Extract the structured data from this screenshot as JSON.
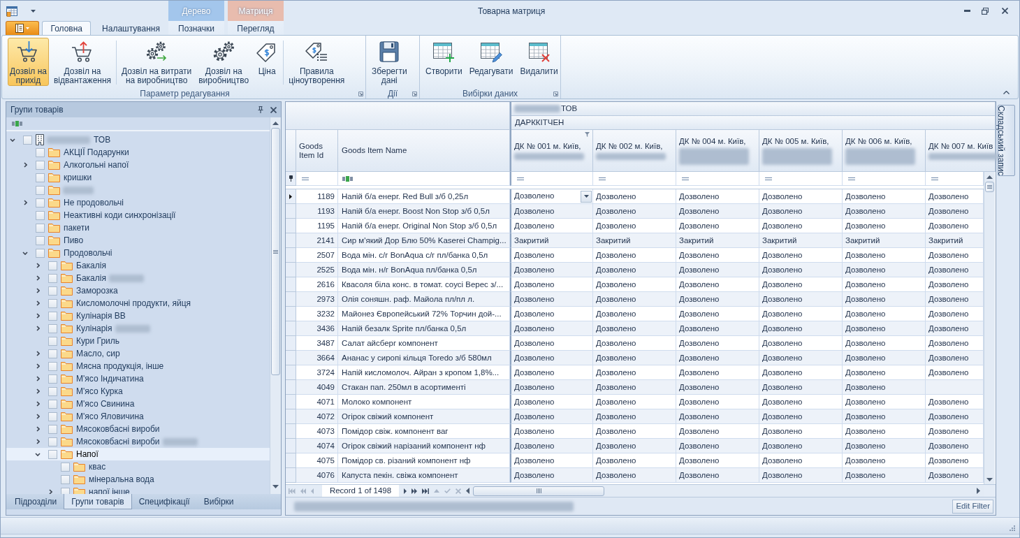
{
  "window": {
    "title": "Товарна матриця"
  },
  "ribbon": {
    "tabs": [
      {
        "label": "Головна",
        "selected": true
      },
      {
        "label": "Налаштування",
        "selected": false
      }
    ],
    "contextual_groups": [
      {
        "label": "Дерево",
        "color": "#a3c6ec",
        "tabs": [
          {
            "label": "Позначки",
            "selected": false
          }
        ]
      },
      {
        "label": "Матриця",
        "color": "#e8bcae",
        "tabs": [
          {
            "label": "Перегляд",
            "selected": false
          }
        ]
      }
    ],
    "groups": [
      {
        "label": "Параметр редагування",
        "sections": [
          [
            {
              "label": "Дозвіл на\nприхід",
              "selected": true
            },
            {
              "label": "Дозвіл на\nвідвантаження",
              "selected": false
            }
          ],
          [
            {
              "label": "Дозвіл на витрати\nна виробництво",
              "selected": false
            },
            {
              "label": "Дозвіл на\nвиробництво",
              "selected": false
            },
            {
              "label": "Ціна",
              "selected": false
            }
          ],
          [
            {
              "label": "Правила\nціноутворення",
              "selected": false
            }
          ]
        ]
      },
      {
        "label": "Дії",
        "sections": [
          [
            {
              "label": "Зберегти\nдані",
              "selected": false
            }
          ]
        ]
      },
      {
        "label": "Вибірки даних",
        "sections": [
          [
            {
              "label": "Створити",
              "selected": false
            },
            {
              "label": "Редагувати",
              "selected": false
            },
            {
              "label": "Видалити",
              "selected": false
            }
          ]
        ]
      }
    ]
  },
  "side_panel": {
    "title": "Групи товарів",
    "tree": [
      {
        "label": "ТОВ",
        "redacted_before": true,
        "kind": "company",
        "checked": false,
        "selected": false,
        "expanded": true,
        "children": [
          {
            "label": "АКЦІЇ Подарунки",
            "kind": "folder",
            "checked": false,
            "selected": false
          },
          {
            "label": "Алкогольні напої",
            "kind": "folder",
            "checked": false,
            "selected": false,
            "expanded": false
          },
          {
            "label": "кришки",
            "kind": "folder",
            "checked": false,
            "selected": false
          },
          {
            "redacted_after": true,
            "kind": "folder",
            "checked": false,
            "selected": false
          },
          {
            "label": "Не продовольчі",
            "kind": "folder",
            "checked": false,
            "selected": false,
            "expanded": false
          },
          {
            "label": "Неактивні коди синхронізації",
            "kind": "folder",
            "checked": false,
            "selected": false
          },
          {
            "label": "пакети",
            "kind": "folder",
            "checked": false,
            "selected": false
          },
          {
            "label": "Пиво",
            "kind": "folder",
            "checked": false,
            "selected": false
          },
          {
            "label": "Продовольчі",
            "kind": "folder",
            "checked": false,
            "selected": false,
            "expanded": true,
            "children": [
              {
                "label": "Бакалія",
                "kind": "folder",
                "checked": false,
                "selected": false,
                "expanded": false
              },
              {
                "label": "Бакалія",
                "redacted_after": true,
                "kind": "folder",
                "checked": false,
                "selected": false,
                "expanded": false
              },
              {
                "label": "Заморозка",
                "kind": "folder",
                "checked": false,
                "selected": false,
                "expanded": false
              },
              {
                "label": "Кисломолочні продукти, яйця",
                "kind": "folder",
                "checked": false,
                "selected": false,
                "expanded": false
              },
              {
                "label": "Кулінарія ВВ",
                "kind": "folder",
                "checked": false,
                "selected": false,
                "expanded": false
              },
              {
                "label": "Кулінарія",
                "redacted_after": true,
                "kind": "folder",
                "checked": false,
                "selected": false,
                "expanded": false
              },
              {
                "label": "Кури Гриль",
                "kind": "folder",
                "checked": false,
                "selected": false
              },
              {
                "label": "Масло, сир",
                "kind": "folder",
                "checked": false,
                "selected": false,
                "expanded": false
              },
              {
                "label": "Мясна продукція, інше",
                "kind": "folder",
                "checked": false,
                "selected": false,
                "expanded": false
              },
              {
                "label": "М'ясо Індичатина",
                "kind": "folder",
                "checked": false,
                "selected": false,
                "expanded": false
              },
              {
                "label": "М'ясо Курка",
                "kind": "folder",
                "checked": false,
                "selected": false,
                "expanded": false
              },
              {
                "label": "М'ясо Свинина",
                "kind": "folder",
                "checked": false,
                "selected": false,
                "expanded": false
              },
              {
                "label": "М'ясо Яловичина",
                "kind": "folder",
                "checked": false,
                "selected": false,
                "expanded": false
              },
              {
                "label": "Мясоковбасні вироби",
                "kind": "folder",
                "checked": false,
                "selected": false,
                "expanded": false
              },
              {
                "label": "Мясоковбасні вироби",
                "redacted_after": true,
                "kind": "folder",
                "checked": false,
                "selected": false,
                "expanded": false
              },
              {
                "label": "Напої",
                "kind": "folder",
                "checked": false,
                "selected": true,
                "expanded": true,
                "children": [
                  {
                    "label": "квас",
                    "kind": "folder",
                    "checked": false,
                    "selected": false
                  },
                  {
                    "label": "мінеральна вода",
                    "kind": "folder",
                    "checked": false,
                    "selected": false
                  },
                  {
                    "label": "напої інше",
                    "kind": "folder",
                    "checked": false,
                    "selected": false,
                    "expanded": false
                  }
                ]
              }
            ]
          }
        ]
      }
    ],
    "tabs": [
      {
        "label": "Підрозділи",
        "selected": false
      },
      {
        "label": "Групи товарів",
        "selected": true
      },
      {
        "label": "Специфікації",
        "selected": false
      },
      {
        "label": "Вибірки",
        "selected": false
      }
    ]
  },
  "grid": {
    "bands": [
      {
        "label": "ТОВ",
        "redacted_before": true
      },
      {
        "label": "ДАРККІТЧЕН",
        "redacted_before": false
      }
    ],
    "columns": [
      {
        "label": "Goods Item Id"
      },
      {
        "label": "Goods Item Name"
      }
    ],
    "store_columns": [
      {
        "label": "ДК № 001 м. Київ,",
        "redacted_detail": true,
        "detail_two_lines": false,
        "filtered": true
      },
      {
        "label": "ДК № 002 м. Київ,",
        "redacted_detail": true,
        "detail_two_lines": false,
        "filtered": false
      },
      {
        "label": "ДК № 004 м. Київ,",
        "redacted_detail": true,
        "detail_two_lines": true,
        "filtered": false
      },
      {
        "label": "ДК № 005 м. Київ,",
        "redacted_detail": true,
        "detail_two_lines": true,
        "filtered": false
      },
      {
        "label": "ДК № 006 м. Київ,",
        "redacted_detail": true,
        "detail_two_lines": true,
        "filtered": false
      },
      {
        "label": "ДК № 007 м. Київ",
        "redacted_detail": true,
        "detail_two_lines": false,
        "filtered": false
      }
    ],
    "rows": [
      {
        "id": "1189",
        "name": "Напій б/а енерг. Red Bull з/б 0,25л",
        "selected": true,
        "values": [
          "Дозволено",
          "Дозволено",
          "Дозволено",
          "Дозволено",
          "Дозволено",
          "Дозволено"
        ]
      },
      {
        "id": "1193",
        "name": "Напій б/а енерг. Boost Non Stop з/б 0,5л",
        "selected": false,
        "values": [
          "Дозволено",
          "Дозволено",
          "Дозволено",
          "Дозволено",
          "Дозволено",
          "Дозволено"
        ]
      },
      {
        "id": "1195",
        "name": "Напій б/а енерг. Original Non Stop з/б 0,5л",
        "selected": false,
        "values": [
          "Дозволено",
          "Дозволено",
          "Дозволено",
          "Дозволено",
          "Дозволено",
          "Дозволено"
        ]
      },
      {
        "id": "2141",
        "name": "Сир м'який Дор Блю 50% Kaserei Champig...",
        "selected": false,
        "values": [
          "Закритий",
          "Закритий",
          "Закритий",
          "Закритий",
          "Закритий",
          "Закритий"
        ]
      },
      {
        "id": "2507",
        "name": "Вода мін. с/г BonAqua с/г пл/банка 0,5л",
        "selected": false,
        "values": [
          "Дозволено",
          "Дозволено",
          "Дозволено",
          "Дозволено",
          "Дозволено",
          "Дозволено"
        ]
      },
      {
        "id": "2525",
        "name": "Вода мін. н/г BonAqua пл/банка 0,5л",
        "selected": false,
        "values": [
          "Дозволено",
          "Дозволено",
          "Дозволено",
          "Дозволено",
          "Дозволено",
          "Дозволено"
        ]
      },
      {
        "id": "2616",
        "name": "Квасоля біла конс. в томат. соусі Верес з/...",
        "selected": false,
        "values": [
          "Дозволено",
          "Дозволено",
          "Дозволено",
          "Дозволено",
          "Дозволено",
          "Дозволено"
        ]
      },
      {
        "id": "2973",
        "name": "Олія соняшн. раф. Майола пл/пл л.",
        "selected": false,
        "values": [
          "Дозволено",
          "Дозволено",
          "Дозволено",
          "Дозволено",
          "Дозволено",
          "Дозволено"
        ]
      },
      {
        "id": "3232",
        "name": "Майонез Європейський 72% Торчин дой-...",
        "selected": false,
        "values": [
          "Дозволено",
          "Дозволено",
          "Дозволено",
          "Дозволено",
          "Дозволено",
          "Дозволено"
        ]
      },
      {
        "id": "3436",
        "name": "Напій безалк Sprite пл/банка 0,5л",
        "selected": false,
        "values": [
          "Дозволено",
          "Дозволено",
          "Дозволено",
          "Дозволено",
          "Дозволено",
          "Дозволено"
        ]
      },
      {
        "id": "3487",
        "name": "Салат айсберг компонент",
        "selected": false,
        "values": [
          "Дозволено",
          "Дозволено",
          "Дозволено",
          "Дозволено",
          "Дозволено",
          "Дозволено"
        ]
      },
      {
        "id": "3664",
        "name": "Ананас у сиропі кільця Toredo з/б 580мл",
        "selected": false,
        "values": [
          "Дозволено",
          "Дозволено",
          "Дозволено",
          "Дозволено",
          "Дозволено",
          "Дозволено"
        ]
      },
      {
        "id": "3724",
        "name": "Напій кисломолоч. Айран з кропом 1,8%...",
        "selected": false,
        "values": [
          "Дозволено",
          "Дозволено",
          "Дозволено",
          "Дозволено",
          "Дозволено",
          "Дозволено"
        ]
      },
      {
        "id": "4049",
        "name": "Стакан пап. 250мл в асортименті",
        "selected": false,
        "values": [
          "Дозволено",
          "Дозволено",
          "Дозволено",
          "Дозволено",
          "Дозволено"
        ]
      },
      {
        "id": "4071",
        "name": "Молоко компонент",
        "selected": false,
        "values": [
          "Дозволено",
          "Дозволено",
          "Дозволено",
          "Дозволено",
          "Дозволено",
          "Дозволено"
        ]
      },
      {
        "id": "4072",
        "name": "Огірок свіжий компонент",
        "selected": false,
        "values": [
          "Дозволено",
          "Дозволено",
          "Дозволено",
          "Дозволено",
          "Дозволено",
          "Дозволено"
        ]
      },
      {
        "id": "4073",
        "name": "Помідор свіж. компонент ваг",
        "selected": false,
        "values": [
          "Дозволено",
          "Дозволено",
          "Дозволено",
          "Дозволено",
          "Дозволено",
          "Дозволено"
        ]
      },
      {
        "id": "4074",
        "name": "Огірок свіжий нарізаний компонент нф",
        "selected": false,
        "values": [
          "Дозволено",
          "Дозволено",
          "Дозволено",
          "Дозволено",
          "Дозволено",
          "Дозволено"
        ]
      },
      {
        "id": "4075",
        "name": "Помідор св. різаний компонент нф",
        "selected": false,
        "values": [
          "Дозволено",
          "Дозволено",
          "Дозволено",
          "Дозволено",
          "Дозволено",
          "Дозволено"
        ]
      },
      {
        "id": "4076",
        "name": "Капуста пекін. свіжа компонент",
        "selected": false,
        "values": [
          "Дозволено",
          "Дозволено",
          "Дозволено",
          "Дозволено",
          "Дозволено",
          "Дозволено"
        ]
      }
    ],
    "navigator": {
      "record": "Record 1 of 1498",
      "buttons": [
        {
          "disabled": true
        },
        {
          "disabled": true
        },
        {
          "disabled": true
        },
        {
          "disabled": false
        },
        {
          "disabled": false
        },
        {
          "disabled": false
        },
        {
          "disabled": true
        },
        {
          "disabled": true
        },
        {
          "disabled": true
        }
      ]
    },
    "filter_panel": {
      "condition_redacted": true,
      "edit_button": "Edit Filter"
    }
  },
  "dock_tabs": [
    {
      "label": "Складський запис"
    }
  ]
}
